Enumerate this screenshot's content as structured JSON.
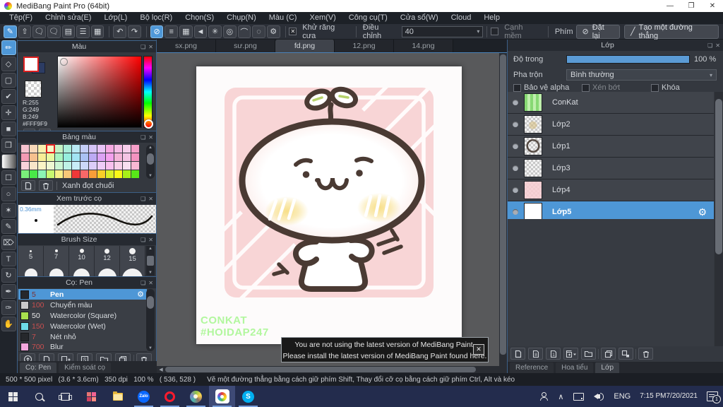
{
  "titlebar": {
    "title": "MediBang Paint Pro (64bit)"
  },
  "menubar": {
    "items": [
      "Tệp(F)",
      "Chỉnh sửa(E)",
      "Lớp(L)",
      "Bộ lọc(R)",
      "Chọn(S)",
      "Chụp(N)",
      "Màu (C)",
      "Xem(V)",
      "Công cụ(T)",
      "Cửa sổ(W)",
      "Cloud",
      "Help"
    ]
  },
  "toolbar": {
    "antialias": "Khử răng cưa",
    "adjust_label": "Điều chỉnh",
    "adjust_value": "40",
    "soft_edge": "Cạnh mềm",
    "key_label": "Phím",
    "reset": "Đặt lại",
    "make_line": "Tạo một đường thẳng"
  },
  "doc_tabs": [
    "sx.png",
    "sư.png",
    "fd.png",
    "12.png",
    "14.png"
  ],
  "canvas": {
    "watermark1": "CONKAT",
    "watermark2": "#HOIDAP247"
  },
  "notification": {
    "line1": "You are not using the latest version of MediBang Paint.",
    "line2": "Please install the latest version of MediBang Paint found here."
  },
  "color_panel": {
    "title": "Màu",
    "r": "R:255",
    "g": "G:249",
    "b": "B:249",
    "hex": "#FFF9F9"
  },
  "palette_panel": {
    "title": "Bảng màu",
    "selected_name": "Xanh đọt chuối",
    "selected_index": 3,
    "colors": [
      "#f6c3cf",
      "#f8d8b8",
      "#faf0ae",
      "#f4f8c8",
      "#c4f2c4",
      "#aaedda",
      "#b9e9f4",
      "#c3cdf6",
      "#d4c3f6",
      "#e8c3f6",
      "#f6a9e2",
      "#f6bce6",
      "#f6cdea",
      "#f69fc9",
      "#f49ab4",
      "#f6c08e",
      "#f8ee96",
      "#e8f8a0",
      "#a8f4c0",
      "#96eede",
      "#a2e4f4",
      "#aac2f4",
      "#bcaaf4",
      "#dca2f4",
      "#f4a0ee",
      "#f4b4d8",
      "#f4c4e4",
      "#f492c0",
      "#f8d2da",
      "#f8e4c8",
      "#faf4c6",
      "#eef8d2",
      "#ccf6d4",
      "#bef2e6",
      "#c8ecf8",
      "#ccd8f8",
      "#dcccf8",
      "#eeccf8",
      "#f8c0ee",
      "#f8d0e8",
      "#f8dff0",
      "#f8b8d4",
      "#7af07a",
      "#48e848",
      "#8cf4b4",
      "#c8f870",
      "#f8f088",
      "#f8c878",
      "#f03838",
      "#f86868",
      "#f89e38",
      "#f8d028",
      "#d8f028",
      "#f8f818",
      "#a8f018",
      "#58e818"
    ]
  },
  "preview_panel": {
    "title": "Xem trước cọ",
    "width_label": "0.36mm"
  },
  "brush_size_panel": {
    "title": "Brush Size",
    "sizes": [
      "5",
      "7",
      "10",
      "12",
      "15"
    ]
  },
  "brush_panel": {
    "title": "Cọ: Pen",
    "brushes": [
      {
        "size": "5",
        "name": "Pen",
        "swatch": "#26282c",
        "size_color": "#7e2f2f"
      },
      {
        "size": "100",
        "name": "Chuyển màu",
        "swatch": "#c9c9c9",
        "size_color": "#c94f4f"
      },
      {
        "size": "50",
        "name": "Watercolor (Square)",
        "swatch": "#a8e04e",
        "size_color": "#e8e8e8"
      },
      {
        "size": "150",
        "name": "Watercolor (Wet)",
        "swatch": "#6edce8",
        "size_color": "#c94f4f"
      },
      {
        "size": "7",
        "name": "Nét nhỏ",
        "swatch": "#26282c",
        "size_color": "#c94f4f"
      },
      {
        "size": "700",
        "name": "Blur",
        "swatch": "#f2a6dd",
        "size_color": "#c94f4f"
      }
    ],
    "tab_active": "Cọ: Pen",
    "tab_other": "Kiểm soát cọ"
  },
  "layers_panel": {
    "title": "Lớp",
    "opacity_label": "Độ trong",
    "opacity_value": "100 %",
    "blend_label": "Pha trộn",
    "blend_value": "Bình thường",
    "protect_alpha": "Bảo vệ alpha",
    "clipping": "Xén bớt",
    "lock": "Khóa",
    "layers": [
      {
        "name": "ConKat"
      },
      {
        "name": "Lớp2"
      },
      {
        "name": "Lớp1"
      },
      {
        "name": "Lớp3"
      },
      {
        "name": "Lớp4"
      },
      {
        "name": "Lớp5"
      }
    ],
    "tabs": [
      "Reference",
      "Hoa tiểu",
      "Lớp"
    ]
  },
  "statusbar": {
    "info": "500 * 500 pixel   (3.6 * 3.6cm)   350 dpi   100 %   ( 536, 528 )",
    "tip": "Vẽ một đường thẳng bằng cách giữ phím Shift, Thay đổi cỡ cọ bằng cách giữ phím Ctrl, Alt và kéo"
  },
  "taskbar": {
    "zalo": "Zalo",
    "skype": "S",
    "lang": "ENG",
    "time": "7:15 PM",
    "date": "7/20/2021",
    "badge": "1"
  },
  "icons": {
    "minimize": "—",
    "restore": "❐",
    "close": "✕",
    "popout": "❏",
    "xclose": "✕",
    "undo": "↶",
    "redo": "↷",
    "main_pen": "✎",
    "export": "⇧",
    "snap_off": "⊘",
    "snap_parallel": "≡",
    "snap_grid": "▦",
    "snap_vanish": "◄",
    "snap_radial": "✳",
    "snap_concentric": "◎",
    "snap_curve": "⌒",
    "snap_ellipse": "◌",
    "gear": "⚙",
    "dropdown": "▾",
    "check": "✕",
    "slash": "╱",
    "up": "▲",
    "down": "▼",
    "left": "◀",
    "chevron_up": "∧",
    "bubble1": "🗨",
    "doc": "▤",
    "doclist": "☰",
    "gridpen": "▦",
    "tools": [
      "✏",
      "◇",
      "▢",
      "✔",
      "✛",
      "■",
      "❒",
      "▩",
      "☐",
      "○",
      "✶",
      "✎",
      "⌦",
      "T",
      "↻",
      "✒",
      "✑",
      "✋"
    ],
    "eight": "8",
    "one": "1",
    "s_label": "S"
  }
}
